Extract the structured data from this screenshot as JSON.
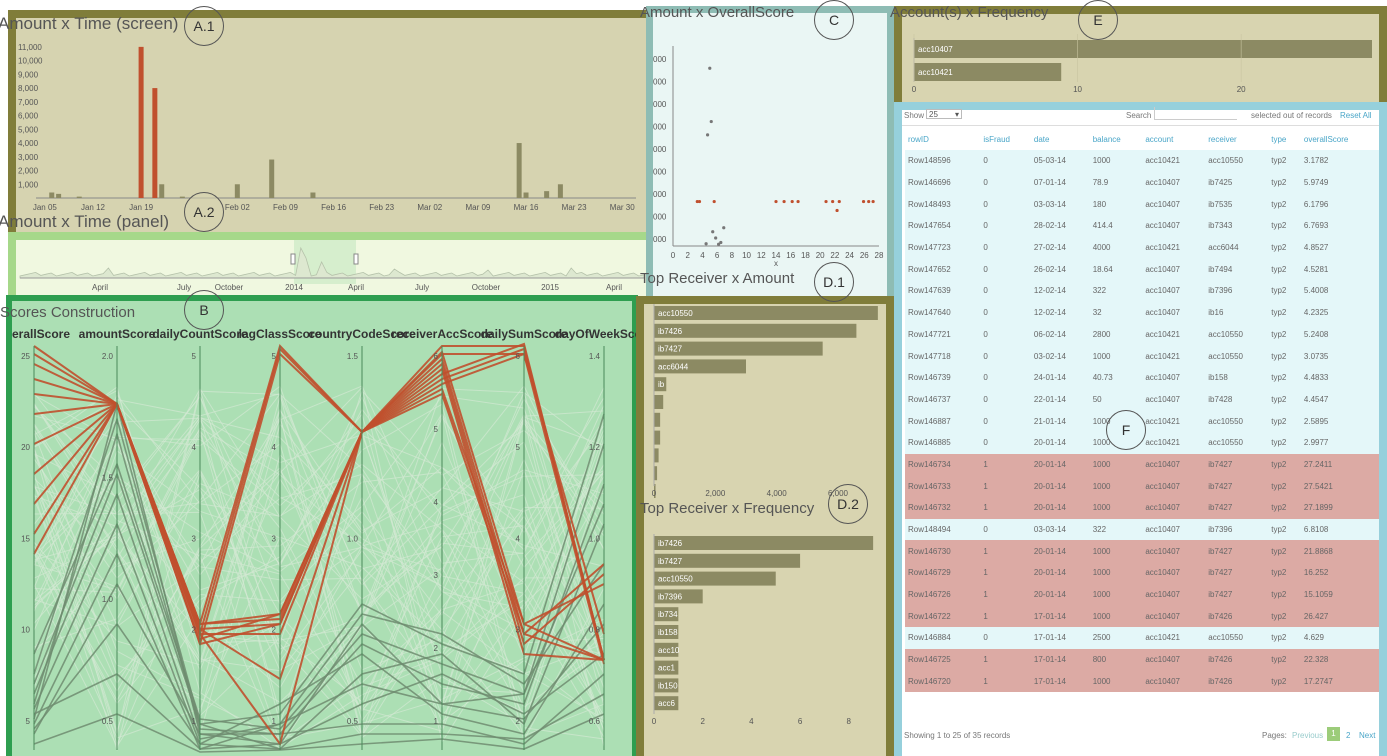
{
  "panels": {
    "a1": {
      "title": "Amount x Time (screen)",
      "badge": "A.1"
    },
    "a2": {
      "title": "Amount x Time (panel)",
      "badge": "A.2"
    },
    "b": {
      "title": "Scores Construction",
      "badge": "B"
    },
    "c": {
      "title": "Amount x OverallScore",
      "badge": "C"
    },
    "d1": {
      "title": "Top Receiver x Amount",
      "badge": "D.1"
    },
    "d2": {
      "title": "Top Receiver x Frequency",
      "badge": "D.2"
    },
    "e": {
      "title": "Account(s) x Frequency",
      "badge": "E"
    },
    "f": {
      "badge": "F"
    }
  },
  "colors": {
    "highlight": "#c0502e",
    "bar": "#8c8a63",
    "green": "#6e8c70"
  },
  "chart_data": [
    {
      "id": "a1",
      "type": "bar",
      "x_ticks": [
        "Jan 05",
        "Jan 12",
        "Jan 19",
        "Feb 02",
        "Feb 09",
        "Feb 16",
        "Feb 23",
        "Mar 02",
        "Mar 09",
        "Mar 16",
        "Mar 23",
        "Mar 30"
      ],
      "y_ticks": [
        "1,000",
        "2,000",
        "3,000",
        "4,000",
        "5,000",
        "6,000",
        "7,000",
        "8,000",
        "9,000",
        "10,000",
        "11,000"
      ],
      "bars": [
        {
          "d": 2,
          "v": 400,
          "c": "n"
        },
        {
          "d": 3,
          "v": 300,
          "c": "n"
        },
        {
          "d": 6,
          "v": 100,
          "c": "n"
        },
        {
          "d": 15,
          "v": 11000,
          "c": "h"
        },
        {
          "d": 17,
          "v": 8000,
          "c": "h"
        },
        {
          "d": 18,
          "v": 1000,
          "c": "n"
        },
        {
          "d": 21,
          "v": 100,
          "c": "n"
        },
        {
          "d": 29,
          "v": 1000,
          "c": "n"
        },
        {
          "d": 34,
          "v": 2800,
          "c": "n"
        },
        {
          "d": 40,
          "v": 400,
          "c": "n"
        },
        {
          "d": 70,
          "v": 4000,
          "c": "n"
        },
        {
          "d": 71,
          "v": 400,
          "c": "n"
        },
        {
          "d": 74,
          "v": 500,
          "c": "n"
        },
        {
          "d": 76,
          "v": 1000,
          "c": "n"
        }
      ]
    },
    {
      "id": "a2",
      "type": "area",
      "x_ticks": [
        "April",
        "July",
        "October",
        "2014",
        "April",
        "July",
        "October",
        "2015",
        "April"
      ]
    },
    {
      "id": "b",
      "type": "parallel-coordinates",
      "axes": [
        {
          "name": "overallScore",
          "ticks": [
            "25",
            "20",
            "15",
            "10",
            "5"
          ]
        },
        {
          "name": "amountScore",
          "ticks": [
            "2.0",
            "1.5",
            "1.0",
            "0.5"
          ]
        },
        {
          "name": "dailyCountScore",
          "ticks": [
            "5",
            "4",
            "3",
            "2",
            "1"
          ]
        },
        {
          "name": "lagClassScore",
          "ticks": [
            "5",
            "4",
            "3",
            "2",
            "1"
          ]
        },
        {
          "name": "countryCodeScore",
          "ticks": [
            "1.5",
            "1.0",
            "0.5"
          ]
        },
        {
          "name": "receiverAccScore",
          "ticks": [
            "6",
            "5",
            "4",
            "3",
            "2",
            "1"
          ]
        },
        {
          "name": "dailySumScore",
          "ticks": [
            "6",
            "5",
            "4",
            "3",
            "2"
          ]
        },
        {
          "name": "dayOfWeekScore",
          "ticks": [
            "1.4",
            "1.2",
            "1.0",
            "0.8",
            "0.6"
          ]
        }
      ]
    },
    {
      "id": "c",
      "type": "scatter",
      "x_ticks": [
        "0",
        "2",
        "4",
        "6",
        "8",
        "10",
        "12",
        "14",
        "16",
        "18",
        "20",
        "22",
        "24",
        "26",
        "28"
      ],
      "x_label": "x",
      "y_ticks": [
        "000",
        "000",
        "000",
        "000",
        "000",
        "000",
        "000",
        "000",
        "000"
      ],
      "points": [
        {
          "x": 3.3,
          "y": 1000,
          "c": "h"
        },
        {
          "x": 3.6,
          "y": 1000,
          "c": "h"
        },
        {
          "x": 4.5,
          "y": 50,
          "c": "n"
        },
        {
          "x": 4.7,
          "y": 2500,
          "c": "n"
        },
        {
          "x": 5.0,
          "y": 4000,
          "c": "n"
        },
        {
          "x": 5.2,
          "y": 2800,
          "c": "n"
        },
        {
          "x": 5.4,
          "y": 320,
          "c": "n"
        },
        {
          "x": 5.6,
          "y": 1000,
          "c": "h"
        },
        {
          "x": 5.8,
          "y": 180,
          "c": "n"
        },
        {
          "x": 6.2,
          "y": 40,
          "c": "n"
        },
        {
          "x": 6.5,
          "y": 80,
          "c": "n"
        },
        {
          "x": 6.9,
          "y": 410,
          "c": "n"
        },
        {
          "x": 14.0,
          "y": 1000,
          "c": "h"
        },
        {
          "x": 15.1,
          "y": 1000,
          "c": "h"
        },
        {
          "x": 16.2,
          "y": 1000,
          "c": "h"
        },
        {
          "x": 17.0,
          "y": 1000,
          "c": "h"
        },
        {
          "x": 20.8,
          "y": 1000,
          "c": "h"
        },
        {
          "x": 21.7,
          "y": 1000,
          "c": "h"
        },
        {
          "x": 22.3,
          "y": 800,
          "c": "h"
        },
        {
          "x": 22.6,
          "y": 1000,
          "c": "h"
        },
        {
          "x": 25.9,
          "y": 1000,
          "c": "h"
        },
        {
          "x": 26.6,
          "y": 1000,
          "c": "h"
        },
        {
          "x": 27.2,
          "y": 1000,
          "c": "h"
        }
      ]
    },
    {
      "id": "d1",
      "type": "bar",
      "categories": [
        "acc10550",
        "ib7426",
        "ib7427",
        "acc6044",
        "ib",
        "",
        "",
        "",
        "",
        "",
        ""
      ],
      "values": [
        7300,
        6600,
        5500,
        3000,
        400,
        300,
        200,
        200,
        150,
        100,
        50
      ],
      "x_ticks": [
        "0",
        "2,000",
        "4,000",
        "6,000"
      ],
      "xlim": [
        0,
        7500
      ]
    },
    {
      "id": "d2",
      "type": "bar",
      "categories": [
        "ib7426",
        "ib7427",
        "acc10550",
        "ib7396",
        "ib734",
        "ib158",
        "acc10",
        "acc1",
        "ib150",
        "acc6"
      ],
      "values": [
        9,
        6,
        5,
        2,
        1,
        1,
        1,
        1,
        1,
        1
      ],
      "x_ticks": [
        "0",
        "2",
        "4",
        "6",
        "8"
      ],
      "xlim": [
        0,
        9.2
      ]
    },
    {
      "id": "e",
      "type": "bar",
      "categories": [
        "acc10407",
        "acc10421"
      ],
      "values": [
        28,
        9
      ],
      "x_ticks": [
        "0",
        "10",
        "20"
      ],
      "xlim": [
        0,
        28
      ]
    }
  ],
  "table": {
    "show_label": "Show",
    "page_size": "25",
    "search_label": "Search",
    "selected_info": "selected out of records",
    "reset_all": "Reset All",
    "columns": [
      "rowID",
      "isFraud",
      "date",
      "balance",
      "account",
      "receiver",
      "type",
      "overallScore"
    ],
    "rows": [
      {
        "rowID": "Row148596",
        "isFraud": "0",
        "date": "05-03-14",
        "balance": "1000",
        "account": "acc10421",
        "receiver": "acc10550",
        "type": "typ2",
        "overallScore": "3.1782"
      },
      {
        "rowID": "Row146696",
        "isFraud": "0",
        "date": "07-01-14",
        "balance": "78.9",
        "account": "acc10407",
        "receiver": "ib7425",
        "type": "typ2",
        "overallScore": "5.9749"
      },
      {
        "rowID": "Row148493",
        "isFraud": "0",
        "date": "03-03-14",
        "balance": "180",
        "account": "acc10407",
        "receiver": "ib7535",
        "type": "typ2",
        "overallScore": "6.1796"
      },
      {
        "rowID": "Row147654",
        "isFraud": "0",
        "date": "28-02-14",
        "balance": "414.4",
        "account": "acc10407",
        "receiver": "ib7343",
        "type": "typ2",
        "overallScore": "6.7693"
      },
      {
        "rowID": "Row147723",
        "isFraud": "0",
        "date": "27-02-14",
        "balance": "4000",
        "account": "acc10421",
        "receiver": "acc6044",
        "type": "typ2",
        "overallScore": "4.8527"
      },
      {
        "rowID": "Row147652",
        "isFraud": "0",
        "date": "26-02-14",
        "balance": "18.64",
        "account": "acc10407",
        "receiver": "ib7494",
        "type": "typ2",
        "overallScore": "4.5281"
      },
      {
        "rowID": "Row147639",
        "isFraud": "0",
        "date": "12-02-14",
        "balance": "322",
        "account": "acc10407",
        "receiver": "ib7396",
        "type": "typ2",
        "overallScore": "5.4008"
      },
      {
        "rowID": "Row147640",
        "isFraud": "0",
        "date": "12-02-14",
        "balance": "32",
        "account": "acc10407",
        "receiver": "ib16",
        "type": "typ2",
        "overallScore": "4.2325"
      },
      {
        "rowID": "Row147721",
        "isFraud": "0",
        "date": "06-02-14",
        "balance": "2800",
        "account": "acc10421",
        "receiver": "acc10550",
        "type": "typ2",
        "overallScore": "5.2408"
      },
      {
        "rowID": "Row147718",
        "isFraud": "0",
        "date": "03-02-14",
        "balance": "1000",
        "account": "acc10421",
        "receiver": "acc10550",
        "type": "typ2",
        "overallScore": "3.0735"
      },
      {
        "rowID": "Row146739",
        "isFraud": "0",
        "date": "24-01-14",
        "balance": "40.73",
        "account": "acc10407",
        "receiver": "ib158",
        "type": "typ2",
        "overallScore": "4.4833"
      },
      {
        "rowID": "Row146737",
        "isFraud": "0",
        "date": "22-01-14",
        "balance": "50",
        "account": "acc10407",
        "receiver": "ib7428",
        "type": "typ2",
        "overallScore": "4.4547"
      },
      {
        "rowID": "Row146887",
        "isFraud": "0",
        "date": "21-01-14",
        "balance": "1000",
        "account": "acc10421",
        "receiver": "acc10550",
        "type": "typ2",
        "overallScore": "2.5895"
      },
      {
        "rowID": "Row146885",
        "isFraud": "0",
        "date": "20-01-14",
        "balance": "1000",
        "account": "acc10421",
        "receiver": "acc10550",
        "type": "typ2",
        "overallScore": "2.9977"
      },
      {
        "rowID": "Row146734",
        "isFraud": "1",
        "date": "20-01-14",
        "balance": "1000",
        "account": "acc10407",
        "receiver": "ib7427",
        "type": "typ2",
        "overallScore": "27.2411"
      },
      {
        "rowID": "Row146733",
        "isFraud": "1",
        "date": "20-01-14",
        "balance": "1000",
        "account": "acc10407",
        "receiver": "ib7427",
        "type": "typ2",
        "overallScore": "27.5421"
      },
      {
        "rowID": "Row146732",
        "isFraud": "1",
        "date": "20-01-14",
        "balance": "1000",
        "account": "acc10407",
        "receiver": "ib7427",
        "type": "typ2",
        "overallScore": "27.1899"
      },
      {
        "rowID": "Row148494",
        "isFraud": "0",
        "date": "03-03-14",
        "balance": "322",
        "account": "acc10407",
        "receiver": "ib7396",
        "type": "typ2",
        "overallScore": "6.8108"
      },
      {
        "rowID": "Row146730",
        "isFraud": "1",
        "date": "20-01-14",
        "balance": "1000",
        "account": "acc10407",
        "receiver": "ib7427",
        "type": "typ2",
        "overallScore": "21.8868"
      },
      {
        "rowID": "Row146729",
        "isFraud": "1",
        "date": "20-01-14",
        "balance": "1000",
        "account": "acc10407",
        "receiver": "ib7427",
        "type": "typ2",
        "overallScore": "16.252"
      },
      {
        "rowID": "Row146726",
        "isFraud": "1",
        "date": "20-01-14",
        "balance": "1000",
        "account": "acc10407",
        "receiver": "ib7427",
        "type": "typ2",
        "overallScore": "15.1059"
      },
      {
        "rowID": "Row146722",
        "isFraud": "1",
        "date": "17-01-14",
        "balance": "1000",
        "account": "acc10407",
        "receiver": "ib7426",
        "type": "typ2",
        "overallScore": "26.427"
      },
      {
        "rowID": "Row146884",
        "isFraud": "0",
        "date": "17-01-14",
        "balance": "2500",
        "account": "acc10421",
        "receiver": "acc10550",
        "type": "typ2",
        "overallScore": "4.629"
      },
      {
        "rowID": "Row146725",
        "isFraud": "1",
        "date": "17-01-14",
        "balance": "800",
        "account": "acc10407",
        "receiver": "ib7426",
        "type": "typ2",
        "overallScore": "22.328"
      },
      {
        "rowID": "Row146720",
        "isFraud": "1",
        "date": "17-01-14",
        "balance": "1000",
        "account": "acc10407",
        "receiver": "ib7426",
        "type": "typ2",
        "overallScore": "17.2747"
      }
    ],
    "footer_info": "Showing 1 to 25 of 35 records",
    "pages_label": "Pages:",
    "prev_label": "Previous",
    "page1": "1",
    "page2": "2",
    "next_label": "Next"
  }
}
